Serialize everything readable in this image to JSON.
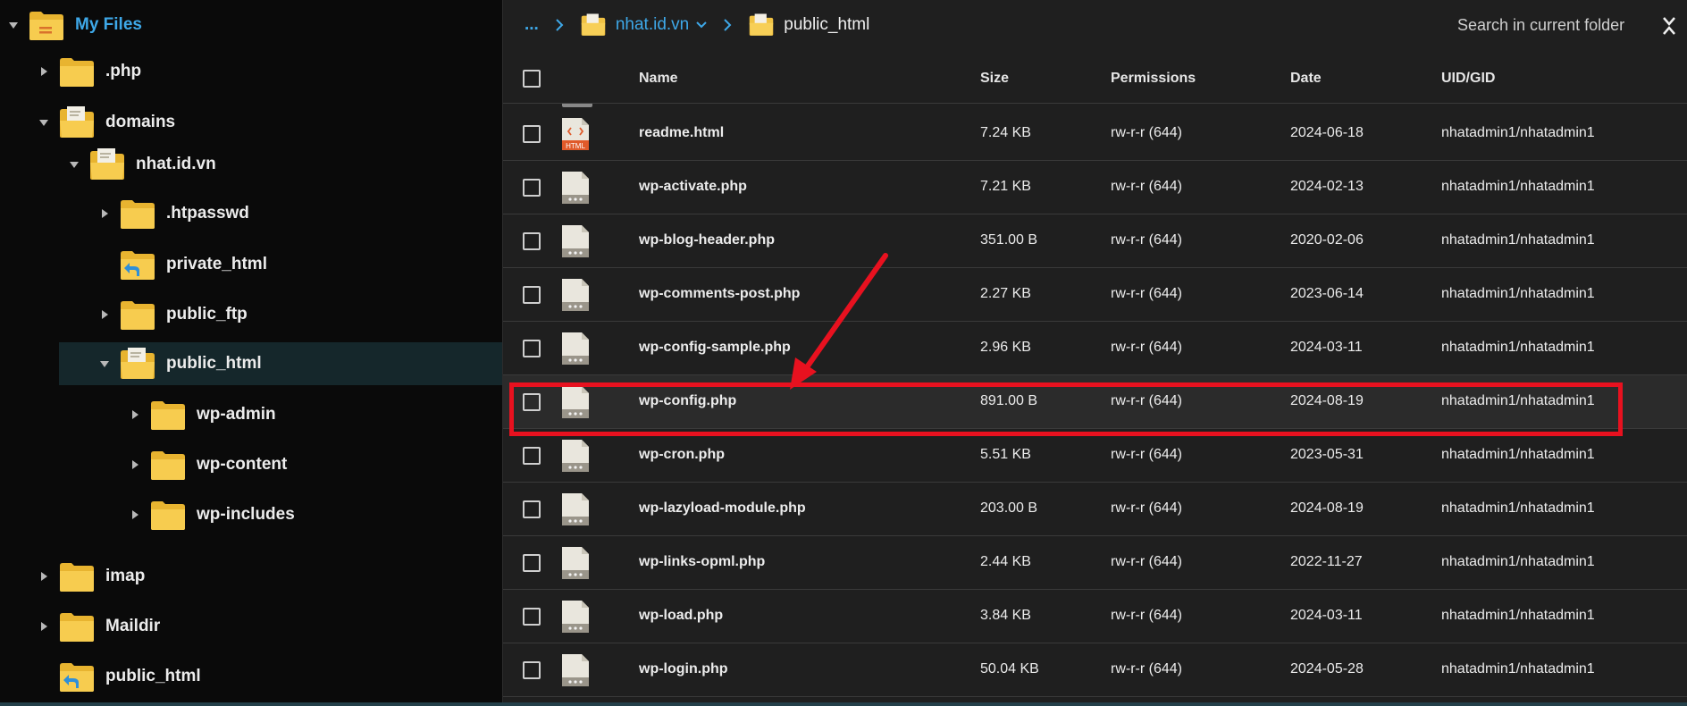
{
  "sidebar": {
    "items": [
      {
        "label": "My Files",
        "depth": 0,
        "caret": "down",
        "icon": "folder-home-icon",
        "root": true
      },
      {
        "label": ".php",
        "depth": 1,
        "caret": "right",
        "icon": "folder-icon"
      },
      {
        "label": "domains",
        "depth": 1,
        "caret": "down",
        "icon": "folder-open-icon"
      },
      {
        "label": "nhat.id.vn",
        "depth": 2,
        "caret": "down",
        "icon": "folder-open-icon"
      },
      {
        "label": ".htpasswd",
        "depth": 3,
        "caret": "right",
        "icon": "folder-icon"
      },
      {
        "label": "private_html",
        "depth": 3,
        "caret": "none",
        "icon": "folder-link-icon"
      },
      {
        "label": "public_ftp",
        "depth": 3,
        "caret": "right",
        "icon": "folder-icon"
      },
      {
        "label": "public_html",
        "depth": 3,
        "caret": "down",
        "icon": "folder-open-icon",
        "selected": true
      },
      {
        "label": "wp-admin",
        "depth": 4,
        "caret": "right",
        "icon": "folder-icon"
      },
      {
        "label": "wp-content",
        "depth": 4,
        "caret": "right",
        "icon": "folder-icon"
      },
      {
        "label": "wp-includes",
        "depth": 4,
        "caret": "right",
        "icon": "folder-icon"
      },
      {
        "label": "imap",
        "depth": 1,
        "caret": "right",
        "icon": "folder-icon"
      },
      {
        "label": "Maildir",
        "depth": 1,
        "caret": "right",
        "icon": "folder-icon"
      },
      {
        "label": "public_html",
        "depth": 1,
        "caret": "none",
        "icon": "folder-link-icon"
      }
    ]
  },
  "breadcrumb": {
    "ellipsis": "...",
    "domain": "nhat.id.vn",
    "current": "public_html"
  },
  "search": {
    "placeholder": "Search in current folder"
  },
  "table": {
    "headers": {
      "name": "Name",
      "size": "Size",
      "permissions": "Permissions",
      "date": "Date",
      "uid": "UID/GID"
    },
    "rows": [
      {
        "name": "readme.html",
        "size": "7.24 KB",
        "perm": "rw-r-r (644)",
        "date": "2024-06-18",
        "uid": "nhatadmin1/nhatadmin1",
        "icon": "html-file-icon",
        "icon_text": "HTML"
      },
      {
        "name": "wp-activate.php",
        "size": "7.21 KB",
        "perm": "rw-r-r (644)",
        "date": "2024-02-13",
        "uid": "nhatadmin1/nhatadmin1",
        "icon": "php-file-icon"
      },
      {
        "name": "wp-blog-header.php",
        "size": "351.00 B",
        "perm": "rw-r-r (644)",
        "date": "2020-02-06",
        "uid": "nhatadmin1/nhatadmin1",
        "icon": "php-file-icon"
      },
      {
        "name": "wp-comments-post.php",
        "size": "2.27 KB",
        "perm": "rw-r-r (644)",
        "date": "2023-06-14",
        "uid": "nhatadmin1/nhatadmin1",
        "icon": "php-file-icon"
      },
      {
        "name": "wp-config-sample.php",
        "size": "2.96 KB",
        "perm": "rw-r-r (644)",
        "date": "2024-03-11",
        "uid": "nhatadmin1/nhatadmin1",
        "icon": "php-file-icon"
      },
      {
        "name": "wp-config.php",
        "size": "891.00 B",
        "perm": "rw-r-r (644)",
        "date": "2024-08-19",
        "uid": "nhatadmin1/nhatadmin1",
        "icon": "php-file-icon",
        "highlighted": true
      },
      {
        "name": "wp-cron.php",
        "size": "5.51 KB",
        "perm": "rw-r-r (644)",
        "date": "2023-05-31",
        "uid": "nhatadmin1/nhatadmin1",
        "icon": "php-file-icon"
      },
      {
        "name": "wp-lazyload-module.php",
        "size": "203.00 B",
        "perm": "rw-r-r (644)",
        "date": "2024-08-19",
        "uid": "nhatadmin1/nhatadmin1",
        "icon": "php-file-icon"
      },
      {
        "name": "wp-links-opml.php",
        "size": "2.44 KB",
        "perm": "rw-r-r (644)",
        "date": "2022-11-27",
        "uid": "nhatadmin1/nhatadmin1",
        "icon": "php-file-icon"
      },
      {
        "name": "wp-load.php",
        "size": "3.84 KB",
        "perm": "rw-r-r (644)",
        "date": "2024-03-11",
        "uid": "nhatadmin1/nhatadmin1",
        "icon": "php-file-icon"
      },
      {
        "name": "wp-login.php",
        "size": "50.04 KB",
        "perm": "rw-r-r (644)",
        "date": "2024-05-28",
        "uid": "nhatadmin1/nhatadmin1",
        "icon": "php-file-icon"
      }
    ]
  },
  "colors": {
    "accent": "#3ea8e8",
    "folder": "#f5c542",
    "highlight": "#e8111f",
    "selected_bg": "#15272b"
  },
  "annotation": {
    "type": "red-arrow-and-box",
    "target": "wp-config.php"
  }
}
